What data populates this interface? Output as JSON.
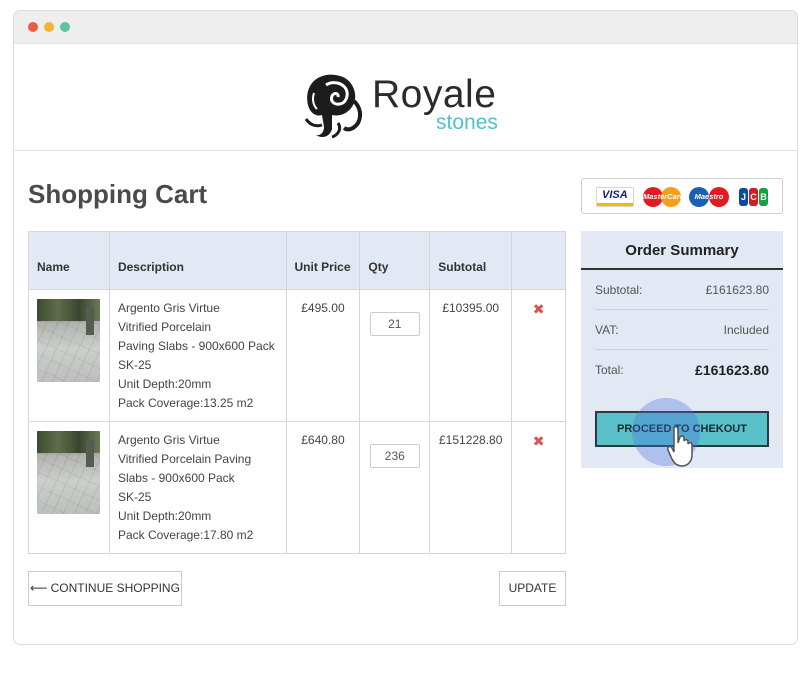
{
  "window": {
    "controls": [
      "close",
      "minimize",
      "maximize"
    ]
  },
  "brand": {
    "name": "Royale",
    "sub": "stones",
    "icon": "elephant-logo-icon",
    "accent": "#55bfc9"
  },
  "page": {
    "title": "Shopping Cart"
  },
  "payment_methods": [
    "VISA",
    "MasterCard",
    "Maestro",
    "JCB"
  ],
  "cart": {
    "headers": {
      "name": "Name",
      "description": "Description",
      "unit_price": "Unit Price",
      "qty": "Qty",
      "subtotal": "Subtotal"
    },
    "items": [
      {
        "image": "paving-slab-thumbnail",
        "description": [
          "Argento Gris Virtue",
          "Vitrified Porcelain",
          "Paving Slabs - 900x600 Pack",
          "SK-25",
          "Unit Depth:20mm",
          "Pack Coverage:13.25 m2"
        ],
        "unit_price": "£495.00",
        "qty": "21",
        "subtotal": "£10395.00",
        "remove_icon": "remove-x-icon"
      },
      {
        "image": "paving-slab-thumbnail",
        "description": [
          "Argento Gris Virtue",
          "Vitrified Porcelain Paving",
          "Slabs - 900x600 Pack",
          "SK-25",
          "Unit Depth:20mm",
          "Pack Coverage:17.80 m2"
        ],
        "unit_price": "£640.80",
        "qty": "236",
        "subtotal": "£151228.80",
        "remove_icon": "remove-x-icon"
      }
    ],
    "continue_label": "⟵ CONTINUE SHOPPING",
    "update_label": "UPDATE"
  },
  "summary": {
    "title": "Order Summary",
    "subtotal_label": "Subtotal:",
    "subtotal_value": "£161623.80",
    "vat_label": "VAT:",
    "vat_value": "Included",
    "total_label": "Total:",
    "total_value": "£161623.80",
    "checkout_label": "PROCEED TO CHEKOUT",
    "checkout_color": "#5ac0c9"
  }
}
